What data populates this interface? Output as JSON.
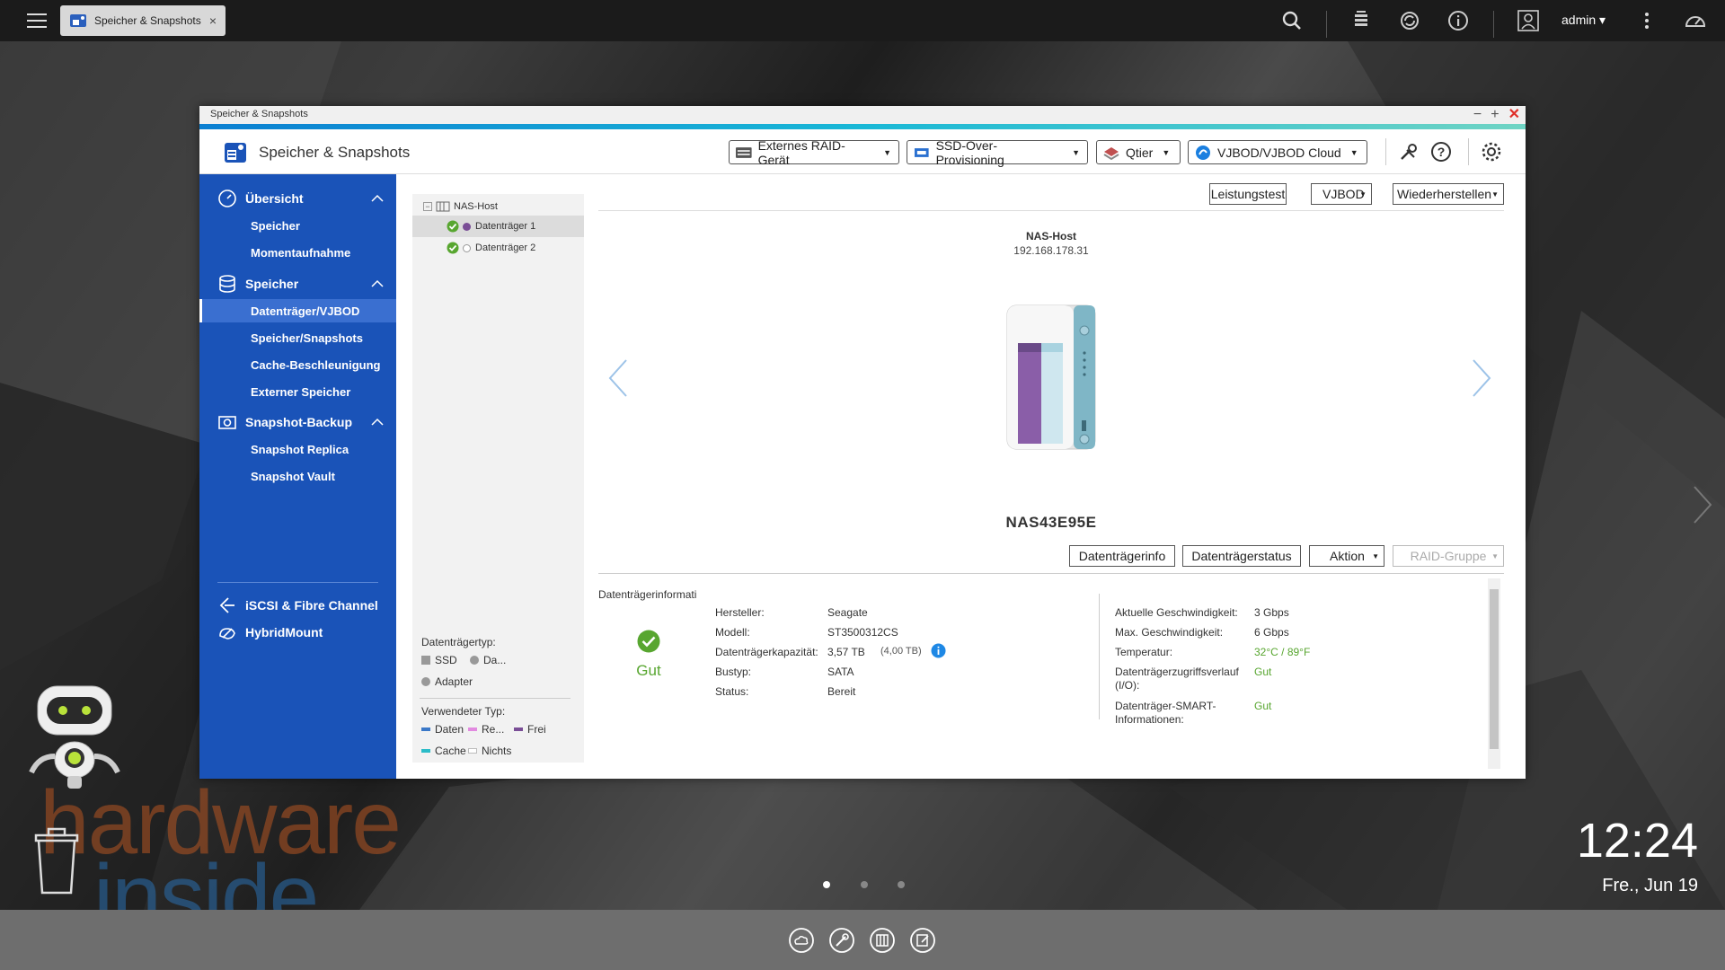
{
  "taskbar": {
    "tab_label": "Speicher & Snapshots",
    "tab_close": "×",
    "user": "admin ▾"
  },
  "window": {
    "title_bar": "Speicher & Snapshots",
    "app_title": "Speicher & Snapshots",
    "controls": {
      "minimize": "−",
      "maximize": "+",
      "close": "✕"
    },
    "header_buttons": [
      {
        "label": "Externes RAID-Gerät",
        "icon": "raid-device-icon"
      },
      {
        "label": "SSD-Over-Provisioning",
        "icon": "ssd-icon"
      },
      {
        "label": "Qtier",
        "icon": "qtier-icon"
      },
      {
        "label": "VJBOD/VJBOD Cloud",
        "icon": "vjbod-cloud-icon"
      }
    ]
  },
  "sidebar": {
    "groups": [
      {
        "label": "Übersicht",
        "icon": "dashboard-icon",
        "items": [
          "Speicher",
          "Momentaufnahme"
        ]
      },
      {
        "label": "Speicher",
        "icon": "database-icon",
        "items": [
          "Datenträger/VJBOD",
          "Speicher/Snapshots",
          "Cache-Beschleunigung",
          "Externer Speicher"
        ]
      },
      {
        "label": "Snapshot-Backup",
        "icon": "snapshot-backup-icon",
        "items": [
          "Snapshot Replica",
          "Snapshot Vault"
        ]
      }
    ],
    "extra": [
      {
        "label": "iSCSI & Fibre Channel",
        "icon": "iscsi-icon"
      },
      {
        "label": "HybridMount",
        "icon": "hybridmount-icon"
      }
    ]
  },
  "tree": {
    "root": "NAS-Host",
    "disks": [
      "Datenträger 1",
      "Datenträger 2"
    ],
    "legend_type_title": "Datenträgertyp:",
    "legend_types": [
      "SSD",
      "Da...",
      "Adapter"
    ],
    "legend_used_title": "Verwendeter Typ:",
    "legend_used": [
      "Daten",
      "Re...",
      "Frei",
      "Cache",
      "Nichts"
    ]
  },
  "toolbar": {
    "benchmark": "Leistungstest",
    "vjbod": "VJBOD",
    "restore": "Wiederherstellen"
  },
  "device": {
    "host_label": "NAS-Host",
    "ip": "192.168.178.31",
    "name": "NAS43E95E"
  },
  "disk_actions": {
    "info": "Datenträgerinfo",
    "status": "Datenträgerstatus",
    "action": "Aktion",
    "raid_group": "RAID-Gruppe"
  },
  "disk_info": {
    "section_title": "Datenträgerinformati",
    "health": "Gut",
    "left": [
      {
        "label": "Hersteller:",
        "value": "Seagate"
      },
      {
        "label": "Modell:",
        "value": "ST3500312CS"
      },
      {
        "label": "Datenträgerkapazität:",
        "value": "3,57 TB",
        "extra": "(4,00 TB)"
      },
      {
        "label": "Bustyp:",
        "value": "SATA"
      },
      {
        "label": "Status:",
        "value": "Bereit"
      }
    ],
    "right": [
      {
        "label": "Aktuelle Geschwindigkeit:",
        "value": "3 Gbps"
      },
      {
        "label": "Max. Geschwindigkeit:",
        "value": "6 Gbps"
      },
      {
        "label": "Temperatur:",
        "value": "32°C / 89°F"
      },
      {
        "label": "Datenträgerzugriffsverlauf (I/O):",
        "value": "Gut"
      },
      {
        "label": "Datenträger-SMART-Informationen:",
        "value": "Gut"
      }
    ]
  },
  "desktop": {
    "clock": "12:24",
    "date": "Fre., Jun 19",
    "watermark_line1": "hardware",
    "watermark_line2": "inside"
  },
  "colors": {
    "sidebar": "#1a53b8",
    "accent_blue": "#0b7fd2",
    "good_green": "#58a630",
    "close_red": "#e0302a"
  }
}
